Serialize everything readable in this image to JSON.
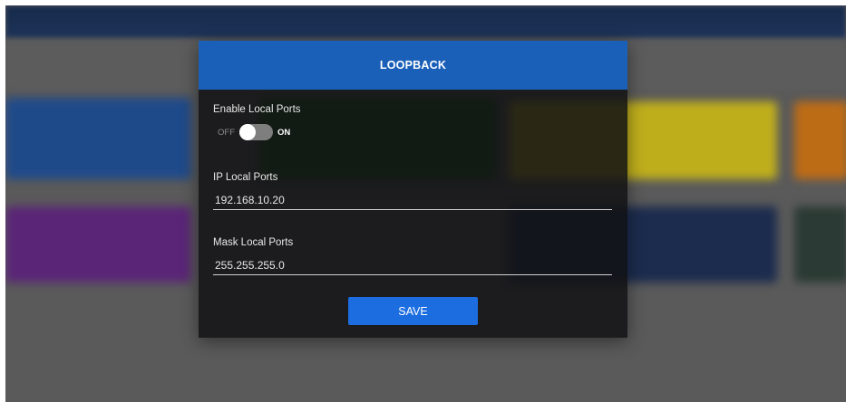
{
  "dialog": {
    "title": "LOOPBACK",
    "enable_label": "Enable Local Ports",
    "toggle": {
      "off_label": "OFF",
      "on_label": "ON",
      "state": "off"
    },
    "ip_label": "IP Local Ports",
    "ip_value": "192.168.10.20",
    "mask_label": "Mask Local Ports",
    "mask_value": "255.255.255.0",
    "save_label": "SAVE"
  },
  "colors": {
    "header": "#1b60b8",
    "save_button": "#1b6de0",
    "modal_bg": "#121214",
    "toggle_track": "#7e7e7e"
  }
}
